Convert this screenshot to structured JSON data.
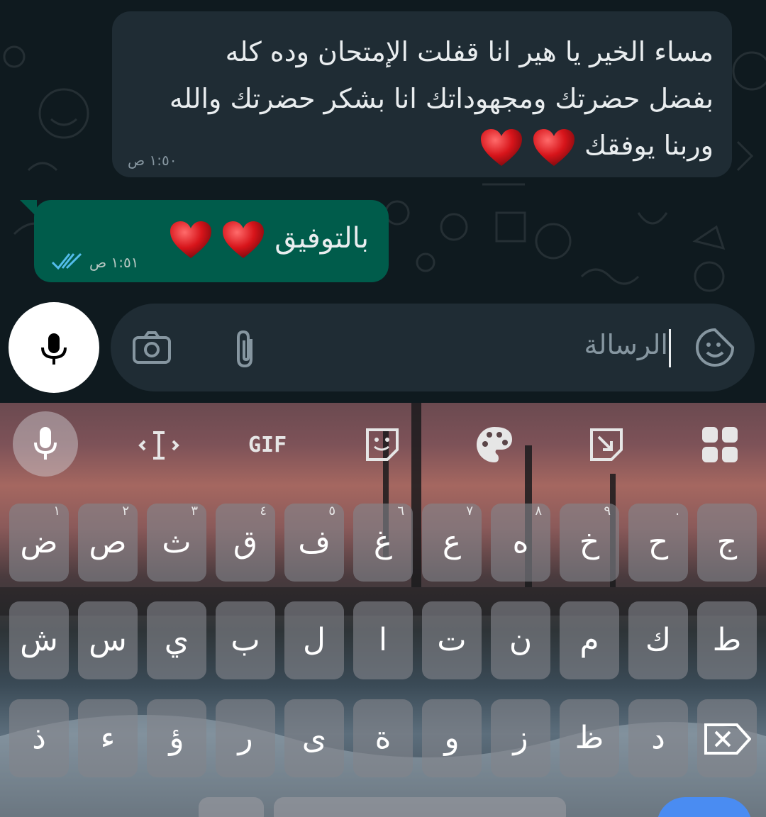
{
  "chat": {
    "incoming": {
      "lines": [
        "مساء الخير يا هير  انا قفلت الإمتحان وده كله",
        "بفضل حضرتك ومجهوداتك انا بشكر حضرتك والله",
        "وربنا يوفقك"
      ],
      "time": "١:٥٠ ص"
    },
    "outgoing": {
      "text": "بالتوفيق",
      "time": "١:٥١ ص"
    }
  },
  "composer": {
    "placeholder": "الرسالة"
  },
  "keyboard": {
    "toolbar": {
      "gif_label": "GIF"
    },
    "row1": [
      {
        "key": "ج",
        "hint": ""
      },
      {
        "key": "ح",
        "hint": "."
      },
      {
        "key": "خ",
        "hint": "٩"
      },
      {
        "key": "ه",
        "hint": "٨"
      },
      {
        "key": "ع",
        "hint": "٧"
      },
      {
        "key": "غ",
        "hint": "٦"
      },
      {
        "key": "ف",
        "hint": "٥"
      },
      {
        "key": "ق",
        "hint": "٤"
      },
      {
        "key": "ث",
        "hint": "٣"
      },
      {
        "key": "ص",
        "hint": "٢"
      },
      {
        "key": "ض",
        "hint": "١"
      }
    ],
    "row2": [
      "ط",
      "ك",
      "م",
      "ن",
      "ت",
      "ا",
      "ل",
      "ب",
      "ي",
      "س",
      "ش"
    ],
    "row3": [
      "د",
      "ظ",
      "ز",
      "و",
      "ة",
      "ى",
      "ر",
      "ؤ",
      "ء",
      "ذ"
    ]
  },
  "colors": {
    "incoming_bubble": "#1f2c34",
    "outgoing_bubble": "#005c4b",
    "read_ticks": "#53bdeb",
    "chat_bg": "#0f1a1f"
  }
}
